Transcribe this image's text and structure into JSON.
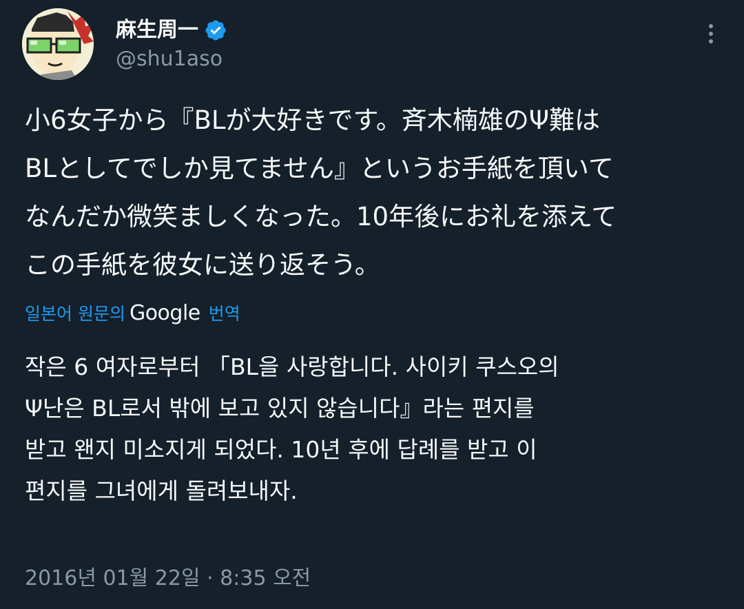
{
  "tweet": {
    "display_name": "麻生周一",
    "handle": "@shu1aso",
    "verified": true,
    "text_lines": [
      "小6女子から『BLが大好きです。斉木楠雄のΨ難は",
      "BLとしてでしか見てません』というお手紙を頂いて",
      "なんだか微笑ましくなった。10年後にお礼を添えて",
      "この手紙を彼女に送り返そう。"
    ],
    "translation": {
      "link_prefix": "일본어 원문의",
      "provider": "Google",
      "link_suffix": "번역",
      "lines": [
        "작은 6 여자로부터 「BL을 사랑합니다. 사이키 쿠스오의",
        "Ψ난은 BL로서 밖에 보고 있지 않습니다』라는 편지를",
        "받고 왠지 미소지게 되었다. 10년 후에 답례를 받고 이",
        "편지를 그녀에게 돌려보내자."
      ]
    },
    "timestamp": "2016년 01월 22일 · 8:35 오전"
  },
  "icons": {
    "verified": "verified-badge-icon",
    "more": "more-options-icon",
    "avatar": "avatar"
  },
  "colors": {
    "background": "#15202b",
    "text": "#f7f9f9",
    "secondary_text": "#8b98a5",
    "accent": "#1d9bf0"
  }
}
